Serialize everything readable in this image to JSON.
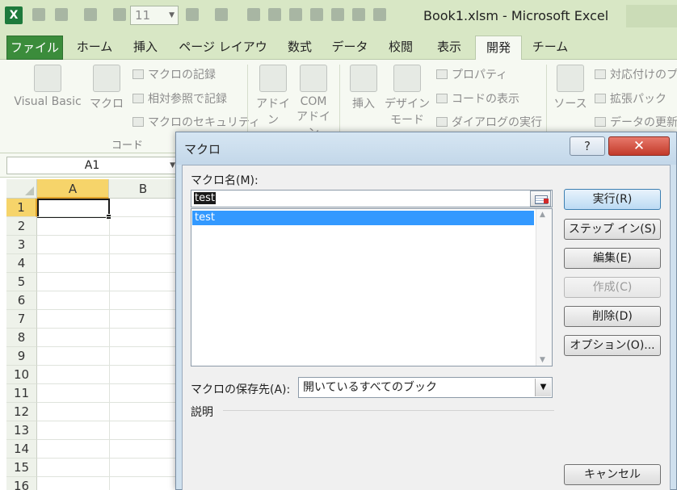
{
  "window": {
    "title": "Book1.xlsm - Microsoft Excel",
    "font_size": "11",
    "app_icon": "X"
  },
  "ribbon": {
    "tabs": [
      "ファイル",
      "ホーム",
      "挿入",
      "ページ レイアウト",
      "数式",
      "データ",
      "校閲",
      "表示",
      "開発",
      "チーム"
    ],
    "active_tab": "開発",
    "code_group": {
      "label": "コード",
      "visual_basic": "Visual Basic",
      "macro": "マクロ",
      "record_macro": "マクロの記録",
      "relative_ref": "相対参照で記録",
      "macro_security": "マクロのセキュリティ"
    },
    "addins_group": {
      "addin": "アドイン",
      "com_addin_1": "COM",
      "com_addin_2": "アドイン"
    },
    "controls_group": {
      "insert": "挿入",
      "design_mode_1": "デザイン",
      "design_mode_2": "モード",
      "properties": "プロパティ",
      "view_code": "コードの表示",
      "run_dialog": "ダイアログの実行"
    },
    "xml_group": {
      "source": "ソース",
      "map_properties": "対応付けのプ",
      "expansion_pack": "拡張パック",
      "refresh_data": "データの更新"
    }
  },
  "namebox": {
    "value": "A1"
  },
  "sheet": {
    "columns": [
      "A",
      "B"
    ],
    "rows": [
      "1",
      "2",
      "3",
      "4",
      "5",
      "6",
      "7",
      "8",
      "9",
      "10",
      "11",
      "12",
      "13",
      "14",
      "15",
      "16"
    ],
    "selected_row": "1",
    "selected_column": "A"
  },
  "dialog": {
    "title": "マクロ",
    "help_label": "?",
    "close_label": "✕",
    "macro_name_label": "マクロ名(M):",
    "macro_name_value": "test",
    "macro_list": [
      "test"
    ],
    "store_label": "マクロの保存先(A):",
    "store_value": "開いているすべてのブック",
    "description_label": "説明",
    "buttons": {
      "run": "実行(R)",
      "step_into": "ステップ イン(S)",
      "edit": "編集(E)",
      "create": "作成(C)",
      "delete": "削除(D)",
      "options": "オプション(O)...",
      "cancel": "キャンセル"
    }
  }
}
